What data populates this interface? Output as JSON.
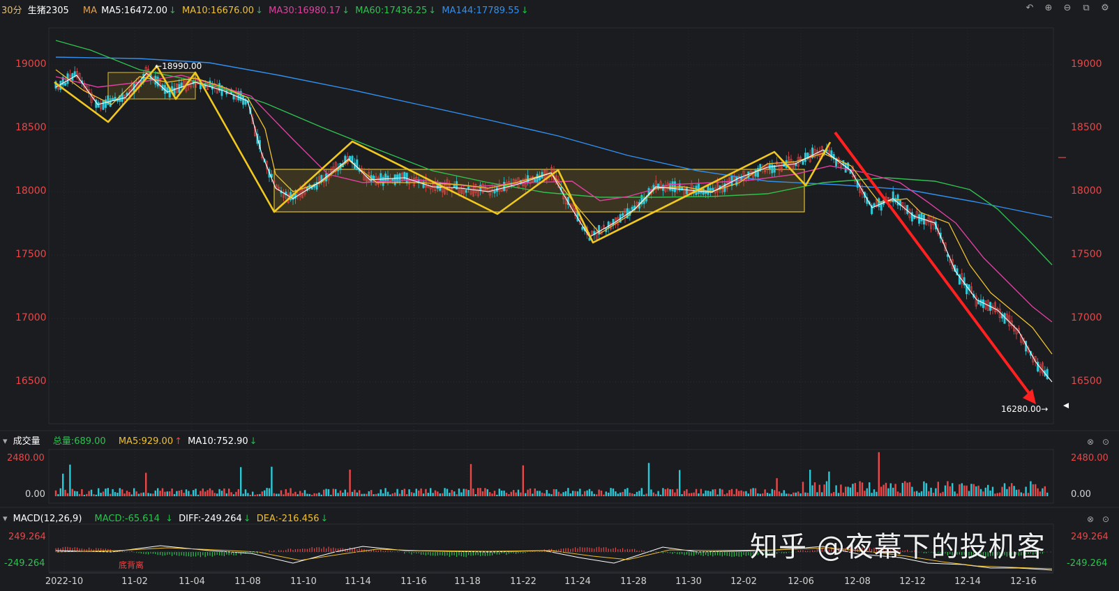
{
  "header": {
    "period": "30分",
    "symbol": "生猪2305",
    "ma_label": "MA",
    "ma5": "MA5:16472.00",
    "ma10": "MA10:16676.00",
    "ma30": "MA30:16980.17",
    "ma60": "MA60:17436.25",
    "ma144": "MA144:17789.55",
    "colors": {
      "ma5": "#ffffff",
      "ma10": "#f0c030",
      "ma30": "#e040a0",
      "ma60": "#30c050",
      "ma144": "#3090f0"
    }
  },
  "toolbar": {
    "icons": [
      "undo-icon",
      "zoom-in-icon",
      "zoom-out-icon",
      "layout-icon",
      "settings-icon"
    ]
  },
  "price_axis": {
    "ticks": [
      "19000",
      "18500",
      "18000",
      "17500",
      "17000",
      "16500"
    ],
    "color": "#e84848"
  },
  "annotations": {
    "high": "18990.00",
    "low": "16280.00"
  },
  "volume_panel": {
    "title": "成交量",
    "total": "总量:689.00",
    "ma5": "MA5:929.00",
    "ma10": "MA10:752.90",
    "ticks": [
      "2480.00",
      "0.00"
    ]
  },
  "macd_panel": {
    "title": "MACD(12,26,9)",
    "macd": "MACD:-65.614",
    "diff": "DIFF:-249.264",
    "dea": "DEA:-216.456",
    "ticks_left": [
      "249.264",
      "-249.264"
    ],
    "ticks_right": [
      "249.264",
      "-249.264"
    ],
    "divergence_label": "底背离"
  },
  "x_axis": {
    "labels": [
      "2022-10",
      "11-02",
      "11-04",
      "11-08",
      "11-10",
      "11-14",
      "11-16",
      "11-18",
      "11-22",
      "11-24",
      "11-28",
      "11-30",
      "12-02",
      "12-06",
      "12-08",
      "12-12",
      "12-14",
      "12-16"
    ]
  },
  "watermark": "知乎 @夜幕下的投机客",
  "chart_data": {
    "type": "line",
    "title": "",
    "ylim": [
      16200,
      19250
    ],
    "x": [
      "2022-10",
      "11-02",
      "11-04",
      "11-08",
      "11-10",
      "11-14",
      "11-16",
      "11-18",
      "11-22",
      "11-24",
      "11-28",
      "11-30",
      "12-02",
      "12-06",
      "12-08",
      "12-12",
      "12-14",
      "12-16"
    ],
    "series": [
      {
        "name": "MA144",
        "values": [
          19050,
          19040,
          19000,
          18920,
          18780,
          18640,
          18540,
          18460,
          18390,
          18310,
          18240,
          18180,
          18130,
          18090,
          18050,
          18020,
          17950,
          17820
        ]
      },
      {
        "name": "MA60",
        "values": [
          19150,
          18950,
          18850,
          18700,
          18500,
          18330,
          18200,
          18080,
          18000,
          17920,
          17910,
          17930,
          17950,
          18010,
          18100,
          18100,
          17920,
          17500
        ]
      },
      {
        "name": "MA30",
        "values": [
          18900,
          18800,
          18880,
          18620,
          18200,
          18080,
          18100,
          17980,
          18080,
          17880,
          17950,
          17980,
          18020,
          18080,
          18180,
          18050,
          17600,
          17020
        ]
      }
    ],
    "high_marker": 18990.0,
    "low_marker": 16280.0,
    "legend": "top-left",
    "grid": true
  }
}
